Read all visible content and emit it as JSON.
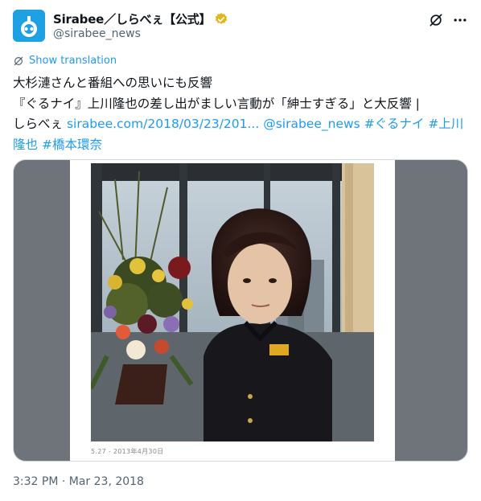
{
  "account": {
    "display_name": "Sirabee／しらべぇ【公式】",
    "handle": "@sirabee_news"
  },
  "translate": {
    "label": "Show translation"
  },
  "tweet": {
    "line1": "大杉漣さんと番組への思いにも反響",
    "line2": "『ぐるナイ』上川隆也の差し出がましい言動が「紳士すぎる」と大反響 |",
    "line3_prefix": "しらべぇ ",
    "link_url": "sirabee.com/2018/03/23/201...",
    "mention": "@sirabee_news",
    "hashtag1": "#ぐるナイ",
    "hashtag2": "#上川隆也",
    "hashtag3": "#橋本環奈"
  },
  "media": {
    "caption": "5.27 - 2013年4月30日"
  },
  "timestamp": "3:32 PM · Mar 23, 2018",
  "colors": {
    "link": "#1d9bf0",
    "avatar_bg": "#1da1e2",
    "verified": "#e2b719"
  }
}
